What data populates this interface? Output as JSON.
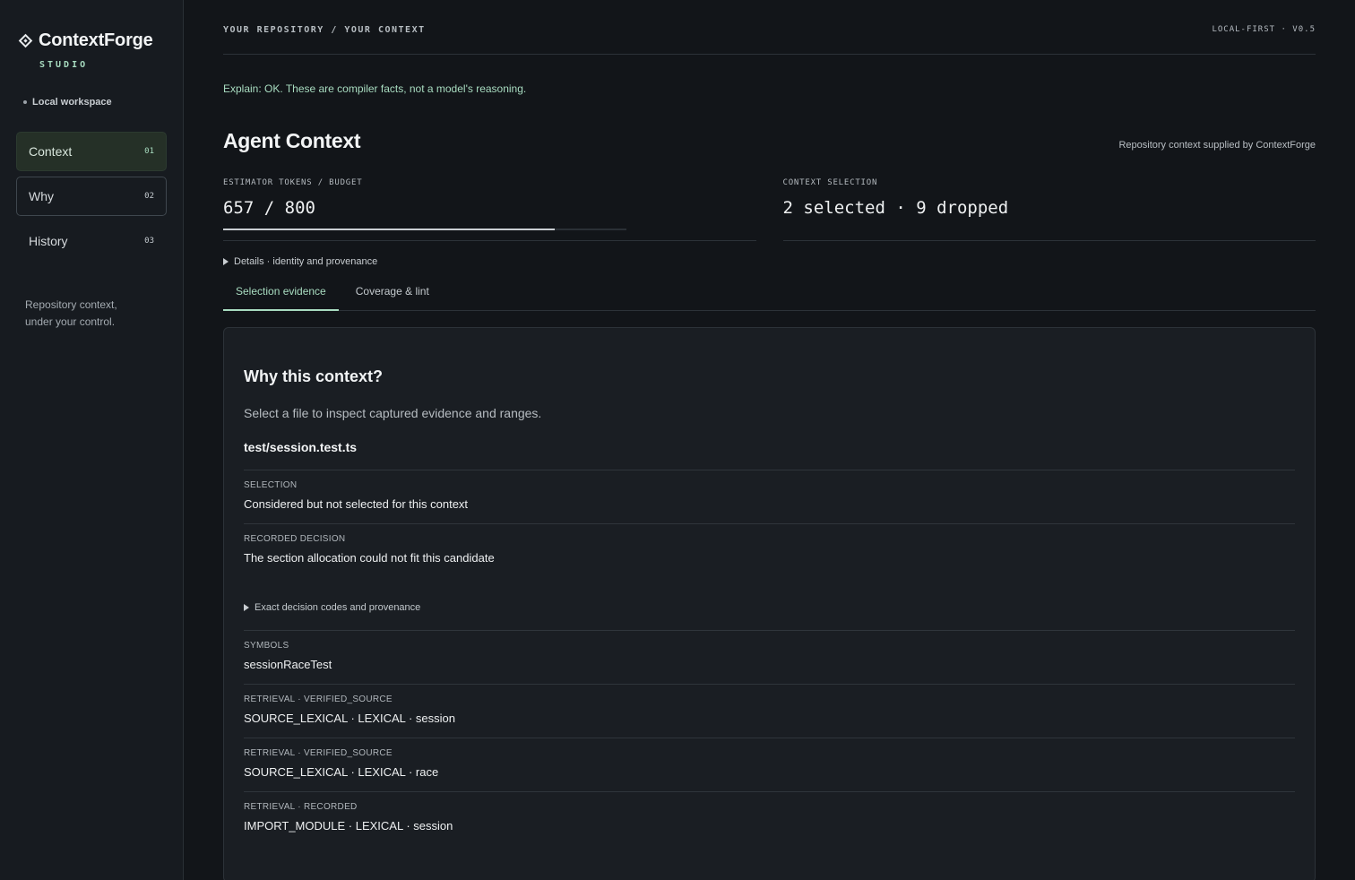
{
  "app": {
    "name": "ContextForge",
    "subtitle": "STUDIO",
    "workspace": "Local workspace",
    "tagline_line1": "Repository context,",
    "tagline_line2": "under your control."
  },
  "nav": {
    "items": [
      {
        "label": "Context",
        "num": "01"
      },
      {
        "label": "Why",
        "num": "02"
      },
      {
        "label": "History",
        "num": "03"
      }
    ]
  },
  "header": {
    "breadcrumb": "YOUR REPOSITORY / YOUR CONTEXT",
    "version": "LOCAL-FIRST · V0.5"
  },
  "explain": "Explain: OK. These are compiler facts, not a model's reasoning.",
  "page": {
    "title": "Agent Context",
    "supplied": "Repository context supplied by ContextForge"
  },
  "stats": {
    "tokens_label": "ESTIMATOR TOKENS / BUDGET",
    "tokens_value": "657 / 800",
    "tokens_used": 657,
    "tokens_budget": 800,
    "selection_label": "CONTEXT SELECTION",
    "selection_value": "2 selected · 9 dropped"
  },
  "details_label": "Details · identity and provenance",
  "tabs": [
    {
      "label": "Selection evidence"
    },
    {
      "label": "Coverage & lint"
    }
  ],
  "panel": {
    "title": "Why this context?",
    "subtitle": "Select a file to inspect captured evidence and ranges.",
    "file": "test/session.test.ts",
    "selection_label": "SELECTION",
    "selection_value": "Considered but not selected for this context",
    "decision_label": "RECORDED DECISION",
    "decision_value": "The section allocation could not fit this candidate",
    "exact_label": "Exact decision codes and provenance",
    "rows": [
      {
        "label": "SYMBOLS",
        "value": "sessionRaceTest"
      },
      {
        "label": "RETRIEVAL · VERIFIED_SOURCE",
        "value": "SOURCE_LEXICAL · LEXICAL · session"
      },
      {
        "label": "RETRIEVAL · VERIFIED_SOURCE",
        "value": "SOURCE_LEXICAL · LEXICAL · race"
      },
      {
        "label": "RETRIEVAL · RECORDED",
        "value": "IMPORT_MODULE · LEXICAL · session"
      }
    ]
  },
  "colors": {
    "accent": "#a8dcc0",
    "background": "#121519",
    "sidebar": "#171b20",
    "panel": "#1a1e23"
  },
  "icons": {
    "brand": "diamond-logo-icon",
    "disclosure": "triangle-right-icon"
  }
}
